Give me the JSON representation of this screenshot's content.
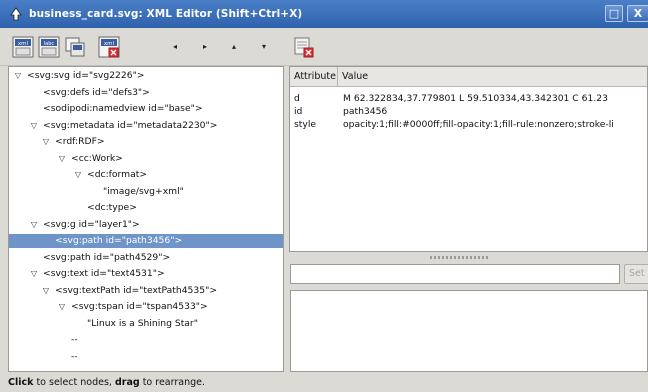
{
  "window": {
    "title": "business_card.svg: XML Editor (Shift+Ctrl+X)",
    "maximize_glyph": "□",
    "close_glyph": "X"
  },
  "toolbar": {
    "tools": [
      {
        "name": "new-element-node",
        "icon": "new-element-node-icon"
      },
      {
        "name": "new-text-node",
        "icon": "new-text-node-icon"
      },
      {
        "name": "duplicate-node",
        "icon": "duplicate-node-icon"
      },
      {
        "name": "delete-node",
        "icon": "delete-node-icon"
      }
    ],
    "arrows": [
      "◂",
      "▸",
      "▴",
      "▾"
    ],
    "delete_attribute_icon": "delete-attribute-icon"
  },
  "tree": {
    "nodes": [
      {
        "indent": 0,
        "expander": "▽",
        "text": "<svg:svg id=\"svg2226\">"
      },
      {
        "indent": 1,
        "expander": "",
        "text": "<svg:defs id=\"defs3\">"
      },
      {
        "indent": 1,
        "expander": "",
        "text": "<sodipodi:namedview id=\"base\">"
      },
      {
        "indent": 1,
        "expander": "▽",
        "text": "<svg:metadata id=\"metadata2230\">"
      },
      {
        "indent": 2,
        "expander": "▽",
        "text": "<rdf:RDF>"
      },
      {
        "indent": 3,
        "expander": "▽",
        "text": "<cc:Work>"
      },
      {
        "indent": 4,
        "expander": "▽",
        "text": "<dc:format>"
      },
      {
        "indent": 5,
        "expander": "",
        "text": "\"image/svg+xml\""
      },
      {
        "indent": 4,
        "expander": "",
        "text": "<dc:type>"
      },
      {
        "indent": 1,
        "expander": "▽",
        "text": "<svg:g id=\"layer1\">"
      },
      {
        "indent": 2,
        "expander": "",
        "text": "<svg:path id=\"path3456\">",
        "selected": true
      },
      {
        "indent": 1,
        "expander": "",
        "text": "<svg:path id=\"path4529\">"
      },
      {
        "indent": 1,
        "expander": "▽",
        "text": "<svg:text id=\"text4531\">"
      },
      {
        "indent": 2,
        "expander": "▽",
        "text": "<svg:textPath id=\"textPath4535\">"
      },
      {
        "indent": 3,
        "expander": "▽",
        "text": "<svg:tspan id=\"tspan4533\">"
      },
      {
        "indent": 4,
        "expander": "",
        "text": "\"Linux is a Shining Star\""
      },
      {
        "indent": 3,
        "expander": "",
        "text": "--"
      },
      {
        "indent": 3,
        "expander": "",
        "text": "--"
      }
    ]
  },
  "attributes": {
    "header_attribute": "Attribute",
    "header_value": "Value",
    "rows": [
      {
        "key": "d",
        "value": "M 62.322834,37.779801 L 59.510334,43.342301 C 61.23"
      },
      {
        "key": "id",
        "value": "path3456"
      },
      {
        "key": "style",
        "value": "opacity:1;fill:#0000ff;fill-opacity:1;fill-rule:nonzero;stroke-li"
      }
    ]
  },
  "editor": {
    "attribute_name_value": "",
    "set_button_label": "Set",
    "attribute_value_text": ""
  },
  "status": {
    "part1_bold": "Click",
    "part2": " to select nodes, ",
    "part3_bold": "drag",
    "part4": " to rearrange."
  },
  "colors": {
    "titlebar": "#3a6db6",
    "selection": "#6f94c8"
  }
}
